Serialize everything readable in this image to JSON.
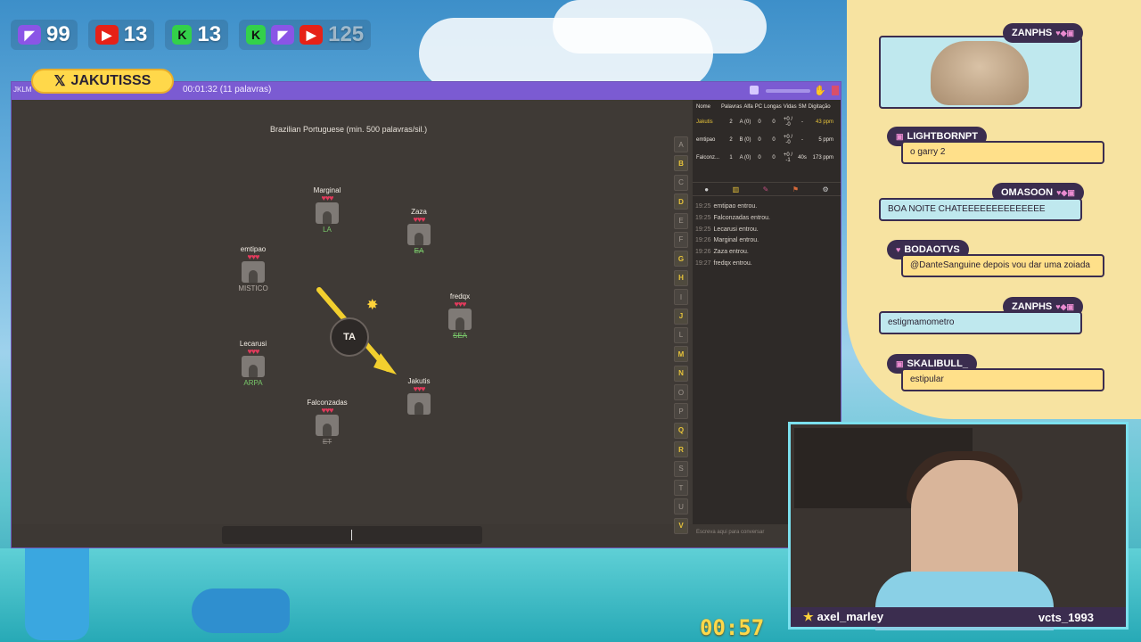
{
  "counters": [
    {
      "platform": "twitch-icon",
      "value": "99"
    },
    {
      "platform": "youtube-icon",
      "value": "13"
    },
    {
      "platform": "kick-icon",
      "value": "13"
    },
    {
      "platform": "total-icon",
      "value": "125"
    }
  ],
  "handle": {
    "icon": "x-logo-icon",
    "text": "JAKUTISSS"
  },
  "game": {
    "brand": "JKLM",
    "timer_text": "00:01:32 (11 palavras)",
    "language": "Brazilian Portuguese (min. 500 palavras/sil.)",
    "syllable": "TA",
    "players": [
      {
        "name": "Marginal",
        "hearts": "♥♥♥",
        "word": "LA"
      },
      {
        "name": "Zaza",
        "hearts": "♥♥♥",
        "word": "EA"
      },
      {
        "name": "emtipao",
        "hearts": "♥♥♥",
        "word": "MISTICO"
      },
      {
        "name": "fredqx",
        "hearts": "♥♥♥",
        "word": "SEA"
      },
      {
        "name": "Lecarusi",
        "hearts": "♥♥♥",
        "word": "ARPA"
      },
      {
        "name": "Jakutis",
        "hearts": "♥♥♥",
        "word": ""
      },
      {
        "name": "Falconzadas",
        "hearts": "♥♥♥",
        "word": "ET"
      }
    ],
    "letters": [
      "A",
      "B",
      "C",
      "D",
      "E",
      "F",
      "G",
      "H",
      "I",
      "J",
      "L",
      "M",
      "N",
      "O",
      "P",
      "Q",
      "R",
      "S",
      "T",
      "U",
      "V"
    ],
    "scoreboard": {
      "headers": [
        "Nome",
        "Palavras",
        "Alfa",
        "PC",
        "Longas",
        "Vidas",
        "SM",
        "Digitação"
      ],
      "rows": [
        {
          "name": "Jakutis",
          "palavras": "2",
          "alfa": "A (0)",
          "pc": "0",
          "longas": "0",
          "vidas": "+0 / -0",
          "sm": "-",
          "ppm": "43 ppm"
        },
        {
          "name": "emtipao",
          "palavras": "2",
          "alfa": "B (0)",
          "pc": "0",
          "longas": "0",
          "vidas": "+0 / -0",
          "sm": "-",
          "ppm": "5 ppm"
        },
        {
          "name": "Falconz...",
          "palavras": "1",
          "alfa": "A (0)",
          "pc": "0",
          "longas": "0",
          "vidas": "+0 / -1",
          "sm": "40s",
          "ppm": "173 ppm"
        }
      ]
    },
    "log": [
      {
        "time": "19:25",
        "text": "emtipao entrou."
      },
      {
        "time": "19:25",
        "text": "Falconzadas entrou."
      },
      {
        "time": "19:25",
        "text": "Lecarusi entrou."
      },
      {
        "time": "19:26",
        "text": "Marginal entrou."
      },
      {
        "time": "19:26",
        "text": "Zaza entrou."
      },
      {
        "time": "19:27",
        "text": "fredqx entrou."
      }
    ],
    "chat_placeholder": "Escreva aqui para conversar"
  },
  "stream_chat": [
    {
      "user": "ZANPHS",
      "message": ""
    },
    {
      "user": "LIGHTBORNPT",
      "message": "o garry 2"
    },
    {
      "user": "OMASOON",
      "message": "BOA NOITE CHATEEEEEEEEEEEEEE"
    },
    {
      "user": "BODAOTVS",
      "message": "@DanteSanguine depois vou dar uma zoiada"
    },
    {
      "user": "ZANPHS",
      "message": "estigmamometro"
    },
    {
      "user": "SKALIBULL_",
      "message": "estipular"
    }
  ],
  "webcam": {
    "left_name": "axel_marley",
    "right_name": "vcts_1993"
  },
  "countdown": "00:57",
  "colors": {
    "accent": "#7b5bd2",
    "heart": "#e23a5c",
    "active_letter": "#e7c33a",
    "chat_tag": "#3b2d4f",
    "chat_msg": "#ffe08a"
  }
}
